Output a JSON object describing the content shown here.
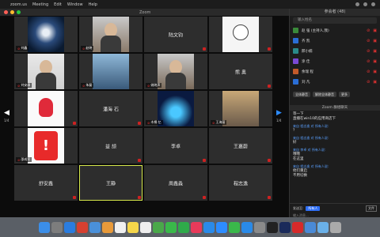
{
  "menubar": {
    "app": "zoom.us",
    "items": [
      "Meeting",
      "Edit",
      "Window",
      "Help"
    ]
  },
  "window": {
    "title": "Zoom"
  },
  "grid": {
    "page_left": "1/4",
    "page_right": "1/4",
    "tiles": [
      {
        "label": "",
        "tag": "刘鑫",
        "has_video": true,
        "kind": "moon"
      },
      {
        "label": "",
        "tag": "赵晓",
        "has_video": true,
        "kind": "face"
      },
      {
        "label": "陆文钧",
        "tag": "",
        "has_video": false
      },
      {
        "label": "",
        "tag": "",
        "has_video": true,
        "kind": "bear"
      },
      {
        "label": "",
        "tag": "刘安康",
        "has_video": true,
        "kind": "person"
      },
      {
        "label": "",
        "tag": "朱磊",
        "has_video": true,
        "kind": "sea"
      },
      {
        "label": "",
        "tag": "姚晓声",
        "has_video": true,
        "kind": "outdoor"
      },
      {
        "label": "熊 奥",
        "tag": "",
        "has_video": false
      },
      {
        "label": "",
        "tag": "",
        "has_video": true,
        "kind": "pokeball"
      },
      {
        "label": "潘海 石",
        "tag": "",
        "has_video": false
      },
      {
        "label": "",
        "tag": "木棉 忆",
        "has_video": true,
        "kind": "blue"
      },
      {
        "label": "",
        "tag": "王海丽",
        "has_video": true,
        "kind": "room"
      },
      {
        "label": "",
        "tag": "邵成军",
        "has_video": true,
        "kind": "alert"
      },
      {
        "label": "益 颉",
        "tag": "",
        "has_video": false
      },
      {
        "label": "李卓",
        "tag": "",
        "has_video": false
      },
      {
        "label": "王嘉蔚",
        "tag": "",
        "has_video": false
      },
      {
        "label": "舒安鑫",
        "tag": "",
        "has_video": false
      },
      {
        "label": "王静",
        "tag": "",
        "has_video": false,
        "highlight": true
      },
      {
        "label": "周鑫淼",
        "tag": "",
        "has_video": false
      },
      {
        "label": "程志逸",
        "tag": "",
        "has_video": false
      }
    ]
  },
  "participants_panel": {
    "title": "参会者 (48)",
    "search_placeholder": "输入姓名",
    "participants": [
      {
        "name": "赵 强 (主持人,我)",
        "avatar_color": "#3a8a3a"
      },
      {
        "name": "齐 凯",
        "avatar_color": "#2a6ed6"
      },
      {
        "name": "邢小楠",
        "avatar_color": "#2a8a8a"
      },
      {
        "name": "涂 佳",
        "avatar_color": "#7a4ad6"
      },
      {
        "name": "余瑞 程",
        "avatar_color": "#c25a2a"
      },
      {
        "name": "刘 凡",
        "avatar_color": "#2a6ed6"
      }
    ],
    "buttons": {
      "mute_all": "全体静音",
      "unmute_all": "解除全体静音",
      "more": "更多"
    }
  },
  "chat_panel": {
    "title": "Zoom 群组聊天",
    "messages": [
      {
        "from": "",
        "text": "等一下"
      },
      {
        "from": "",
        "text": "直播在win10的应用商店下"
      },
      {
        "from": "来自 程志逸 对 所有人说:",
        "text": "？"
      },
      {
        "from": "来自 程志逸 对 所有人说:",
        "text": "好"
      },
      {
        "from": "来自 李卓 对 所有人说:",
        "text": "哦哦\n在这里"
      },
      {
        "from": "来自 程志逸 对 所有人说:",
        "text": "他们重启\n不用切换"
      }
    ],
    "send_to_label": "发送至:",
    "send_to_value": "所有人",
    "file_label": "文件",
    "input_placeholder": "输入消息..."
  },
  "dock": {
    "apps": [
      {
        "name": "finder",
        "color": "#3b8ee8"
      },
      {
        "name": "launchpad",
        "color": "#7d7d7d"
      },
      {
        "name": "safari",
        "color": "#2a7de0"
      },
      {
        "name": "chrome",
        "color": "#d64030"
      },
      {
        "name": "mail",
        "color": "#4a90d9"
      },
      {
        "name": "photos",
        "color": "#e89a3a"
      },
      {
        "name": "calendar",
        "color": "#f0f0f0"
      },
      {
        "name": "notes",
        "color": "#f5d64a"
      },
      {
        "name": "reminders",
        "color": "#eeeeee"
      },
      {
        "name": "maps",
        "color": "#4aa84a"
      },
      {
        "name": "messages",
        "color": "#3ab84a"
      },
      {
        "name": "facetime",
        "color": "#2faa4a"
      },
      {
        "name": "music",
        "color": "#e83a5a"
      },
      {
        "name": "appstore",
        "color": "#2a8ae8"
      },
      {
        "name": "zoom",
        "color": "#2d8cff"
      },
      {
        "name": "wechat",
        "color": "#3ab84a"
      },
      {
        "name": "qq",
        "color": "#2a8ae8"
      },
      {
        "name": "settings",
        "color": "#8a8a8a"
      },
      {
        "name": "terminal",
        "color": "#222222"
      },
      {
        "name": "photoshop",
        "color": "#1a2a5a"
      },
      {
        "name": "netease",
        "color": "#d62a2a"
      },
      {
        "name": "downloads",
        "color": "#4a8ad6"
      },
      {
        "name": "folder",
        "color": "#6ab0e8"
      },
      {
        "name": "trash",
        "color": "#aaaaaa"
      }
    ]
  }
}
